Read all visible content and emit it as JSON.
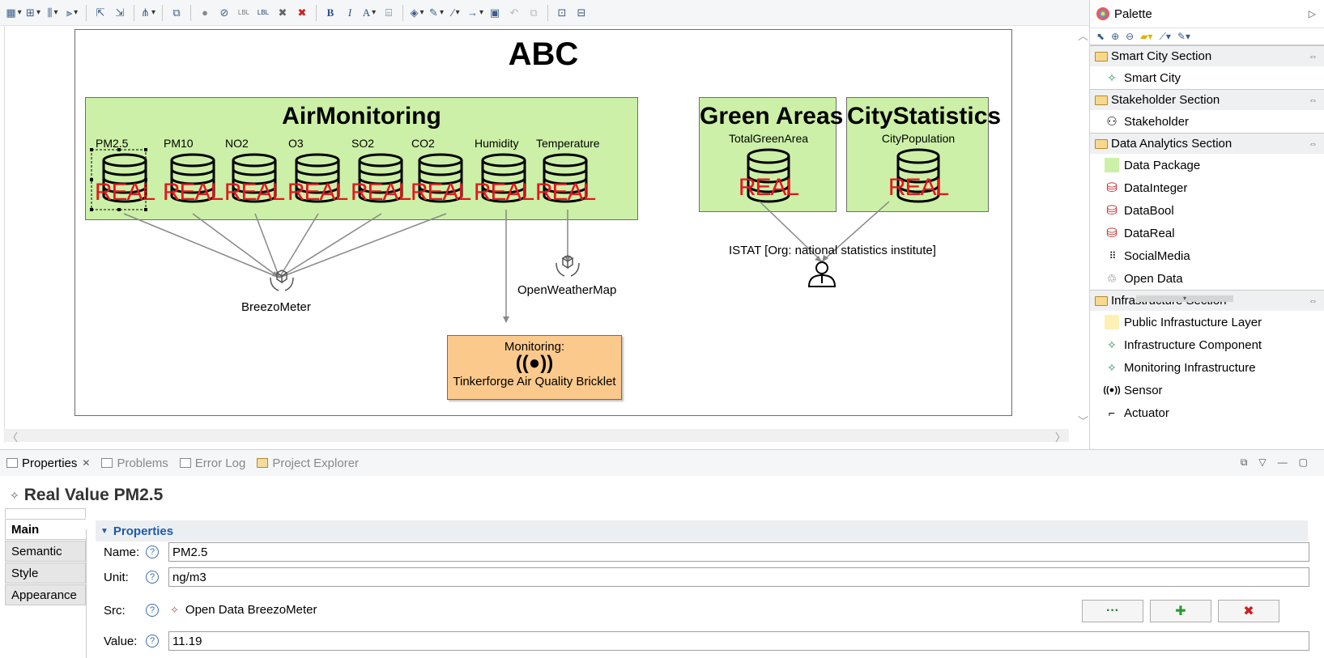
{
  "toolbar": {
    "buttons": [
      "select-dropdown",
      "arrange-dropdown",
      "align-dropdown",
      "layer-dropdown",
      "open-button",
      "export-button",
      "layout-dropdown",
      "copy-format",
      "pin",
      "unpin",
      "show-label",
      "hide-label",
      "delete-from-diagram",
      "delete-from-model",
      "bold",
      "italic",
      "font-color",
      "font",
      "fill-color",
      "line-color",
      "line-style",
      "arrow-style",
      "properties",
      "undo",
      "redo",
      "zoom-fit",
      "zoom-page"
    ]
  },
  "diagram": {
    "title": "ABC",
    "air_monitoring": {
      "title": "AirMonitoring",
      "items": [
        {
          "label": "PM2.5",
          "type": "REAL"
        },
        {
          "label": "PM10",
          "type": "REAL"
        },
        {
          "label": "NO2",
          "type": "REAL"
        },
        {
          "label": "O3",
          "type": "REAL"
        },
        {
          "label": "SO2",
          "type": "REAL"
        },
        {
          "label": "CO2",
          "type": "REAL"
        },
        {
          "label": "Humidity",
          "type": "REAL"
        },
        {
          "label": "Temperature",
          "type": "REAL"
        }
      ]
    },
    "green_areas": {
      "title": "Green Areas",
      "item_label": "TotalGreenArea",
      "type": "REAL"
    },
    "city_statistics": {
      "title": "CityStatistics",
      "item_label": "CityPopulation",
      "type": "REAL"
    },
    "breezometer": "BreezoMeter",
    "openweathermap": "OpenWeatherMap",
    "istat": "ISTAT [Org: national statistics institute]",
    "monitoring": {
      "label": "Monitoring:",
      "name": "Tinkerforge Air Quality Bricklet"
    }
  },
  "palette": {
    "title": "Palette",
    "sections": [
      {
        "title": "Smart City Section",
        "items": [
          {
            "label": "Smart City",
            "icon": "star-icon"
          }
        ]
      },
      {
        "title": "Stakeholder Section",
        "items": [
          {
            "label": "Stakeholder",
            "icon": "person-icon"
          }
        ]
      },
      {
        "title": "Data Analytics Section",
        "items": [
          {
            "label": "Data Package",
            "icon": "green-square-icon"
          },
          {
            "label": "DataInteger",
            "icon": "database-icon"
          },
          {
            "label": "DataBool",
            "icon": "database-icon"
          },
          {
            "label": "DataReal",
            "icon": "database-icon"
          },
          {
            "label": "SocialMedia",
            "icon": "grid-icon"
          },
          {
            "label": "Open Data",
            "icon": "hands-icon"
          }
        ]
      },
      {
        "title": "Infrastructure Section",
        "items": [
          {
            "label": "Public Infrastucture Layer",
            "icon": "yellow-square-icon"
          },
          {
            "label": "Infrastructure Component",
            "icon": "star-icon"
          },
          {
            "label": "Monitoring Infrastructure",
            "icon": "star-icon"
          },
          {
            "label": "Sensor",
            "icon": "sensor-icon"
          },
          {
            "label": "Actuator",
            "icon": "actuator-icon"
          }
        ]
      }
    ]
  },
  "views": {
    "tabs": [
      {
        "label": "Properties",
        "active": true
      },
      {
        "label": "Problems",
        "active": false
      },
      {
        "label": "Error Log",
        "active": false
      },
      {
        "label": "Project Explorer",
        "active": false
      }
    ]
  },
  "properties": {
    "title": "Real Value PM2.5",
    "side_tabs": [
      "Main",
      "Semantic",
      "Style",
      "Appearance"
    ],
    "section": "Properties",
    "fields": {
      "name_label": "Name:",
      "name_value": "PM2.5",
      "unit_label": "Unit:",
      "unit_value": "ng/m3",
      "src_label": "Src:",
      "src_value": "Open Data BreezoMeter",
      "value_label": "Value:",
      "value_value": "11.19"
    },
    "buttons": {
      "browse": "···",
      "add": "✚",
      "remove": "✖"
    },
    "help_glyph": "?"
  }
}
